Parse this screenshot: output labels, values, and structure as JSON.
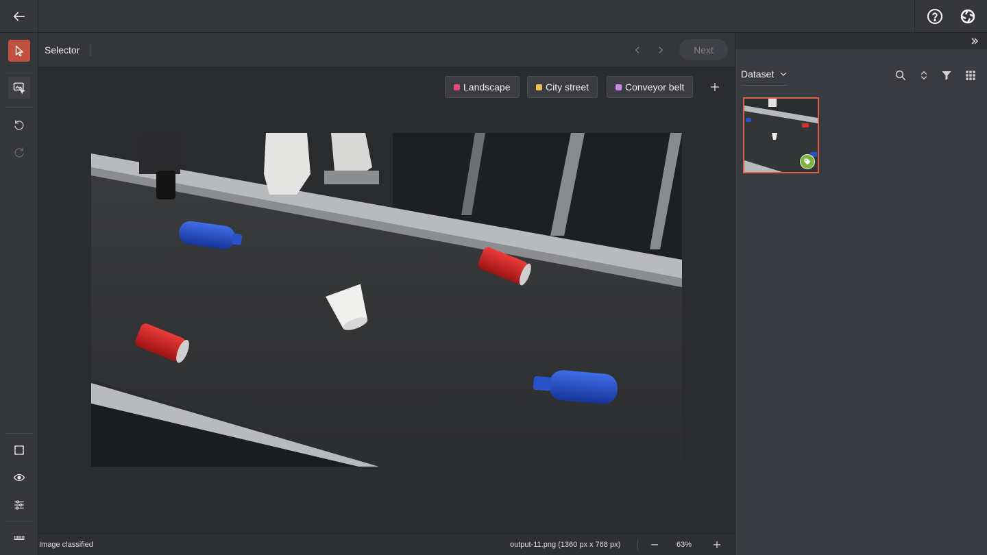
{
  "toolbar": {
    "title": "Selector",
    "next_label": "Next"
  },
  "labels": [
    {
      "name": "Landscape",
      "color": "#e84a7a"
    },
    {
      "name": "City street",
      "color": "#e8c24a"
    },
    {
      "name": "Conveyor belt",
      "color": "#c88ce6"
    }
  ],
  "status": {
    "left_text": "Image classified",
    "file_info": "output-11.png (1360 px x 768 px)",
    "zoom": "63%"
  },
  "panel": {
    "dataset_label": "Dataset"
  },
  "icons": {
    "back": "arrow-left-icon",
    "help": "help-circle-icon",
    "logo": "app-logo-icon",
    "select_tool": "cursor-arrow-icon",
    "classify_tool": "classify-image-icon",
    "undo": "undo-icon",
    "redo": "redo-icon",
    "fit": "fit-screen-icon",
    "visibility": "eye-icon",
    "adjust": "sliders-icon",
    "keyboard": "keyboard-icon",
    "search": "search-icon",
    "sort": "sort-icon",
    "filter": "filter-icon",
    "grid": "grid-icon",
    "tag": "tag-icon"
  },
  "colors": {
    "accent": "#c0503f",
    "thumb_border": "#d9604a",
    "classified_badge": "#7cb342"
  }
}
